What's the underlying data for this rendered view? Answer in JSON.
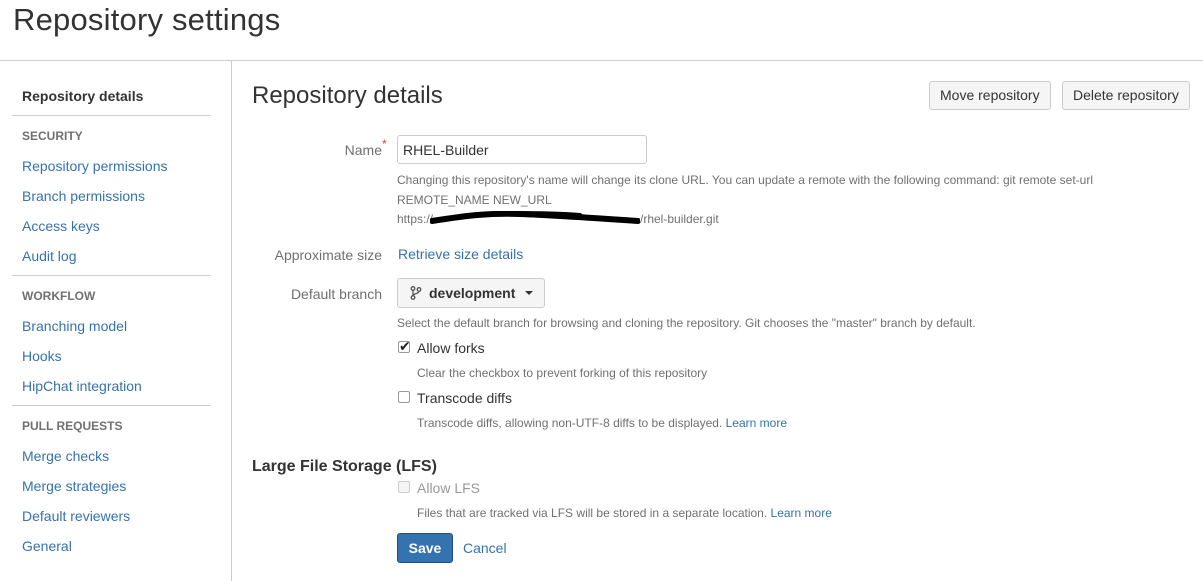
{
  "page_title": "Repository settings",
  "sidebar": {
    "current": "Repository details",
    "sections": [
      {
        "heading": "SECURITY",
        "items": [
          "Repository permissions",
          "Branch permissions",
          "Access keys",
          "Audit log"
        ]
      },
      {
        "heading": "WORKFLOW",
        "items": [
          "Branching model",
          "Hooks",
          "HipChat integration"
        ]
      },
      {
        "heading": "PULL REQUESTS",
        "items": [
          "Merge checks",
          "Merge strategies",
          "Default reviewers",
          "General"
        ]
      }
    ]
  },
  "main": {
    "title": "Repository details",
    "move_button": "Move repository",
    "delete_button": "Delete repository",
    "name_label": "Name",
    "required_marker": "*",
    "name_value": "RHEL-Builder",
    "name_help_line1": "Changing this repository's name will change its clone URL. You can update a remote with the following command: git remote set-url",
    "name_help_line2": "REMOTE_NAME NEW_URL",
    "name_help_url_prefix": "https://",
    "name_help_url_suffix": "/rhel-builder.git",
    "size_label": "Approximate size",
    "size_link": "Retrieve size details",
    "branch_label": "Default branch",
    "branch_value": "development",
    "branch_help": "Select the default branch for browsing and cloning the repository. Git chooses the \"master\" branch by default.",
    "forks_label": "Allow forks",
    "forks_checked": true,
    "forks_help": "Clear the checkbox to prevent forking of this repository",
    "transcode_label": "Transcode diffs",
    "transcode_checked": false,
    "transcode_help": "Transcode diffs, allowing non-UTF-8 diffs to be displayed.",
    "learn_more": "Learn more",
    "lfs_title": "Large File Storage (LFS)",
    "lfs_label": "Allow LFS",
    "lfs_checked": false,
    "lfs_help": "Files that are tracked via LFS will be stored in a separate location.",
    "save_button": "Save",
    "cancel_link": "Cancel"
  },
  "colors": {
    "link": "#3572b0",
    "primary_button": "#3572b0",
    "required": "#d04437",
    "muted_text": "#707070"
  },
  "icons": [
    "branch-icon",
    "chevron-down-icon",
    "checkmark-icon"
  ]
}
